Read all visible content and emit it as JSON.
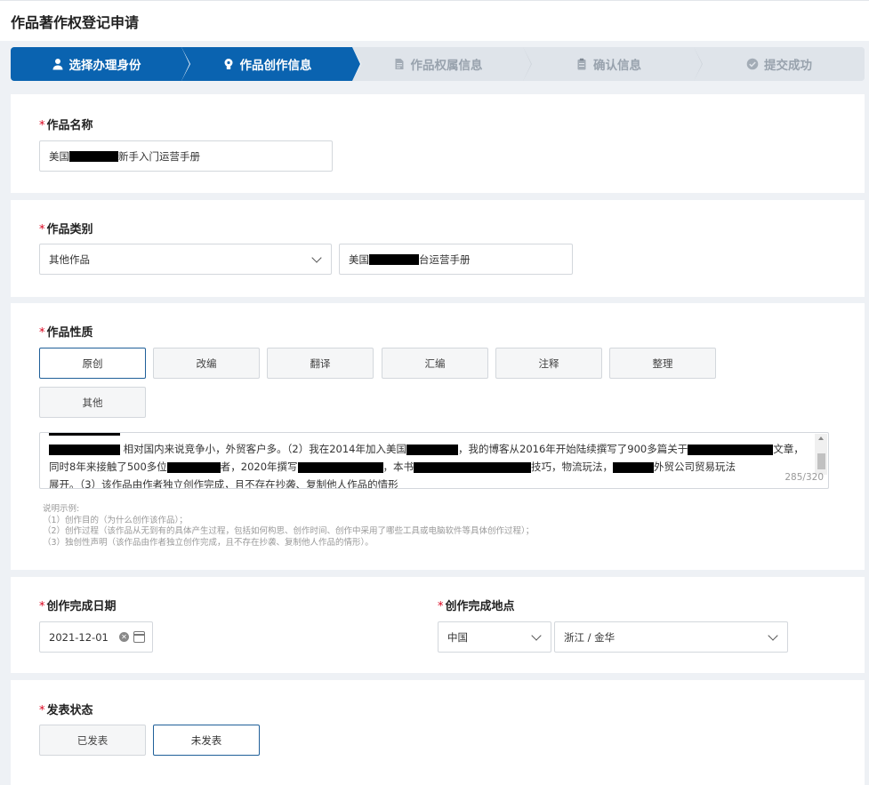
{
  "page": {
    "title": "作品著作权登记申请"
  },
  "steps": [
    {
      "label": "选择办理身份",
      "icon": "user-icon",
      "active": true
    },
    {
      "label": "作品创作信息",
      "icon": "lightbulb-icon",
      "active": true
    },
    {
      "label": "作品权属信息",
      "icon": "document-icon",
      "active": false
    },
    {
      "label": "确认信息",
      "icon": "clipboard-icon",
      "active": false
    },
    {
      "label": "提交成功",
      "icon": "check-circle-icon",
      "active": false
    }
  ],
  "work_name": {
    "label": "作品名称",
    "required_mark": "*",
    "value_prefix": "美国",
    "value_suffix": "新手入门运营手册"
  },
  "work_category": {
    "label": "作品类别",
    "required_mark": "*",
    "selected": "其他作品",
    "detail_prefix": "美国",
    "detail_suffix": "台运营手册"
  },
  "work_nature": {
    "label": "作品性质",
    "required_mark": "*",
    "options": [
      "原创",
      "改编",
      "翻译",
      "汇编",
      "注释",
      "整理",
      "其他"
    ],
    "selected": "原创",
    "description": {
      "line1a": "相对国内来说竞争小，外贸客户多。（2）我在2014年加入美国",
      "line1b": "，我的博客从2016年开始陆续撰写了900多篇关于",
      "line1c": "文章，",
      "line2a": "同时8年来接触了500多位",
      "line2b": "者，2020年撰写",
      "line2c": "，本书",
      "line2d": "技巧，物流玩法，",
      "line2e": "外贸公司贸易玩法",
      "line3": "展开。（3）该作品由作者独立创作完成，且不存在抄袭、复制他人作品的情形",
      "counter": "285/320"
    },
    "hint": [
      "说明示例:",
      "（1）创作目的（为什么创作该作品）；",
      "（2）创作过程（该作品从无到有的具体产生过程，包括如何构思、创作时间、创作中采用了哪些工具或电脑软件等具体创作过程）；",
      "（3）独创性声明（该作品由作者独立创作完成，且不存在抄袭、复制他人作品的情形）。"
    ]
  },
  "completion": {
    "date_label": "创作完成日期",
    "date_value": "2021-12-01",
    "place_label": "创作完成地点",
    "country": "中国",
    "region": "浙江 / 金华",
    "required_mark": "*"
  },
  "publish": {
    "label": "发表状态",
    "required_mark": "*",
    "options": [
      "已发表",
      "未发表"
    ],
    "selected": "未发表"
  },
  "colors": {
    "primary": "#0a63b0",
    "required": "#d9001b",
    "inactive_step": "#dfe4ea"
  }
}
